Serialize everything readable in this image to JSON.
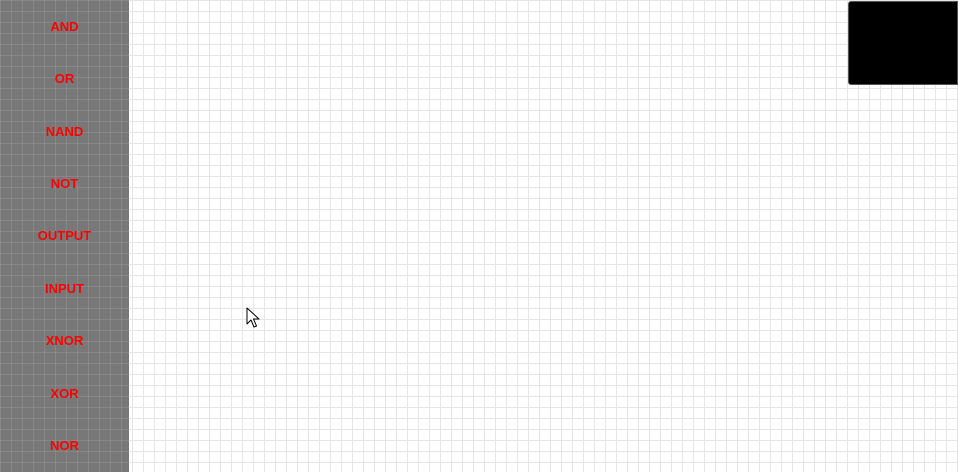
{
  "sidebar": {
    "items": [
      {
        "label": "AND"
      },
      {
        "label": "OR"
      },
      {
        "label": "NAND"
      },
      {
        "label": "NOT"
      },
      {
        "label": "OUTPUT"
      },
      {
        "label": "INPUT"
      },
      {
        "label": "XNOR"
      },
      {
        "label": "XOR"
      },
      {
        "label": "NOR"
      }
    ]
  },
  "icons": {
    "cursor": "mouse-pointer-icon"
  },
  "colors": {
    "sidebar_bg": "#787878",
    "label_color": "#ff0000",
    "grid_line": "#e6e6e6",
    "minimap_bg": "#000000"
  }
}
